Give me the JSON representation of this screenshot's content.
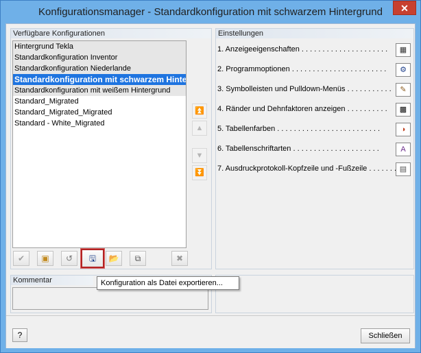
{
  "window": {
    "title": "Konfigurationsmanager - Standardkonfiguration mit schwarzem Hintergrund",
    "close_glyph": "✕"
  },
  "configs": {
    "title": "Verfügbare Konfigurationen",
    "items": [
      "Hintergrund Tekla",
      "Standardkonfiguration Inventor",
      "Standardkonfiguration Niederlande",
      "Standardkonfiguration mit schwarzem Hintergrund",
      "Standardkonfiguration mit weißem Hintergrund",
      "Standard_Migrated",
      "Standard_Migrated_Migrated",
      "Standard - White_Migrated"
    ],
    "selected_index": 3
  },
  "arrows": {
    "top": "⏫",
    "up": "▲",
    "down": "▼",
    "bottom": "⏬"
  },
  "toolbar": {
    "apply": "✔",
    "new": "▣",
    "rename": "↺",
    "export": "🖫",
    "import": "📂",
    "copy": "⧉",
    "delete": "✖"
  },
  "settings": {
    "title": "Einstellungen",
    "items": [
      "1. Anzeigeeigenschaften . . . . . . . . . . . . . . . . . . . . .",
      "2. Programmoptionen . . . . . . . . . . . . . . . . . . . . . . .",
      "3. Symbolleisten und Pulldown-Menüs . . . . . . . . . . .",
      "4. Ränder und Dehnfaktoren anzeigen . . . . . . . . . .",
      "5. Tabellenfarben . . . . . . . . . . . . . . . . . . . . . . . . .",
      "6. Tabellenschriftarten . . . . . . . . . . . . . . . . . . . . .",
      "7. Ausdruckprotokoll-Kopfzeile und -Fußzeile . . . . . . ."
    ],
    "icons": [
      "▦",
      "⚙",
      "✎",
      "▩",
      "◑",
      "A",
      "▤"
    ]
  },
  "comment": {
    "title": "Kommentar"
  },
  "tooltip": {
    "text": "Konfiguration als Datei exportieren..."
  },
  "footer": {
    "help": "?",
    "close_label": "Schließen"
  }
}
